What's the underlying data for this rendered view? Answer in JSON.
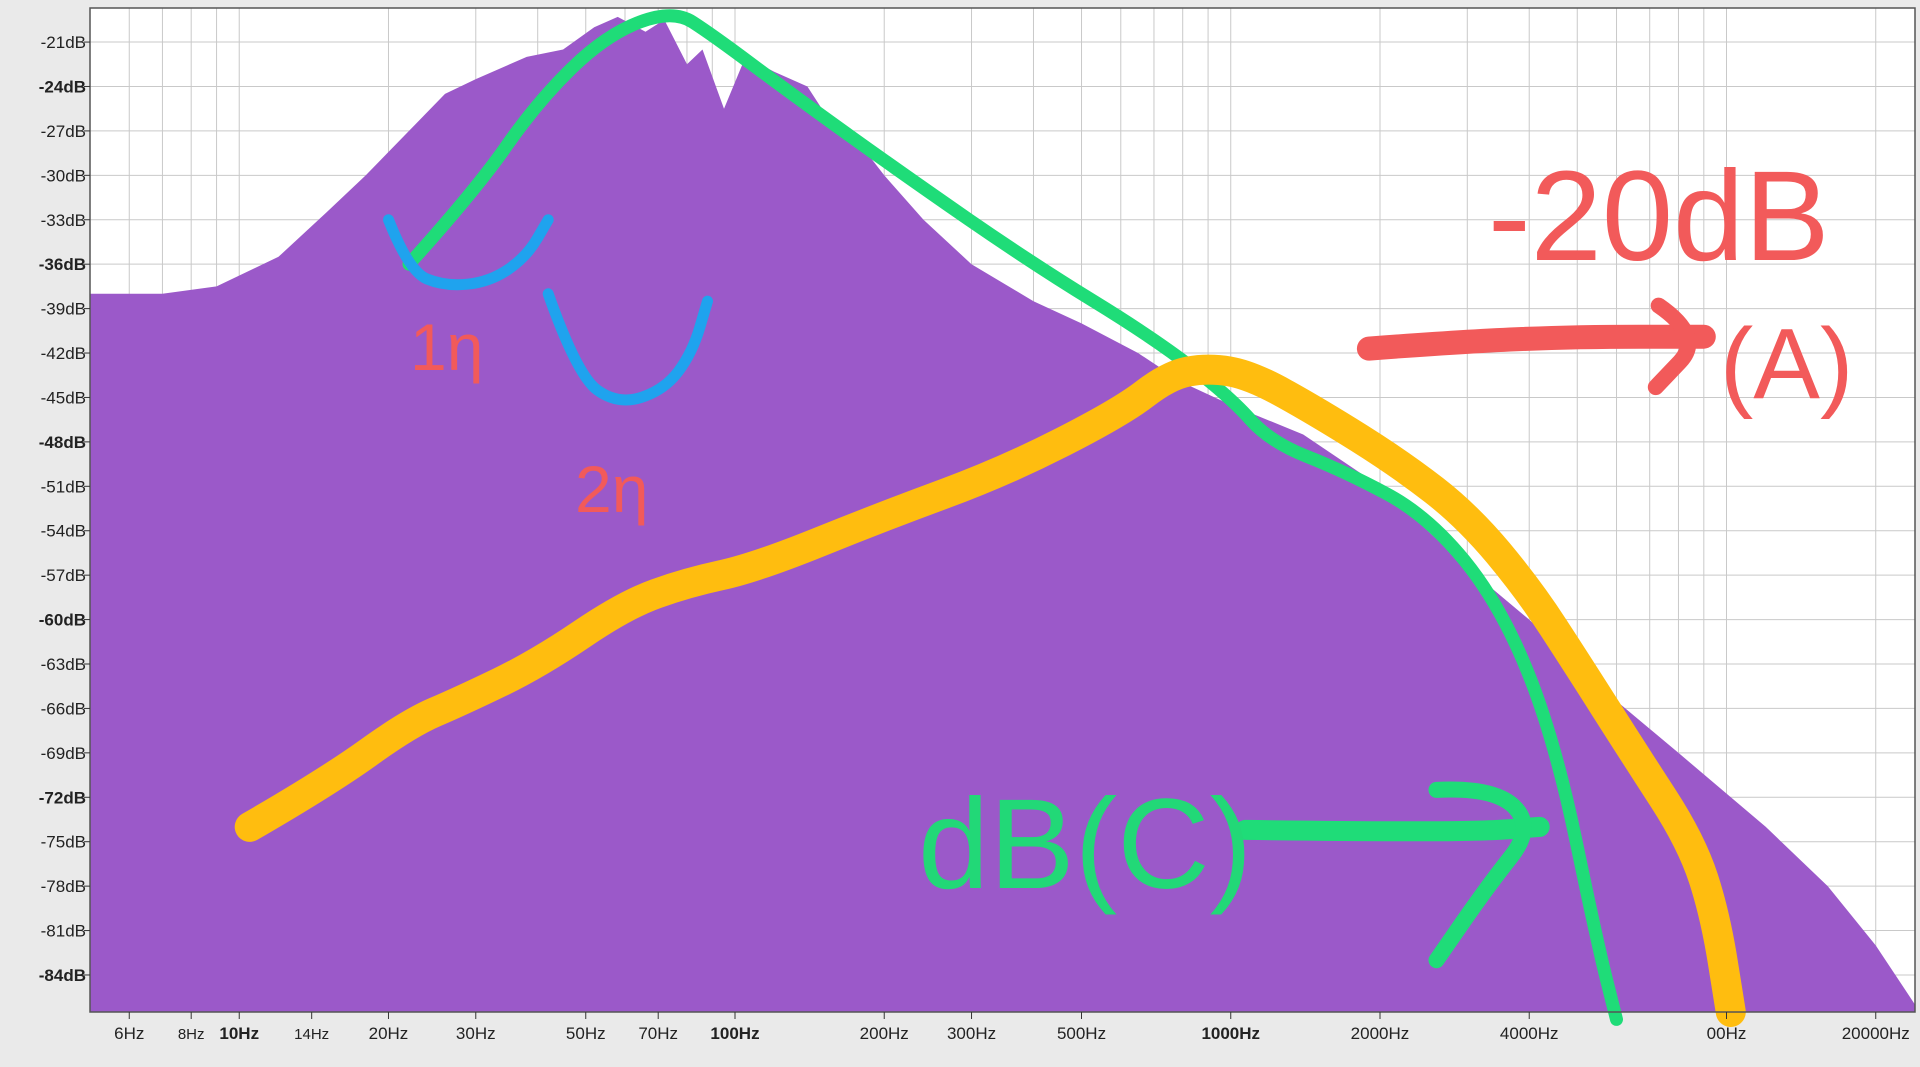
{
  "chart_data": {
    "type": "area",
    "title": "",
    "xlabel": "",
    "ylabel": "",
    "x_scale": "log",
    "xlim": [
      5,
      24000
    ],
    "ylim": [
      -86.5,
      -18.7
    ],
    "grid": true,
    "fill_color": "#9b59c9",
    "x_tick_labels": [
      {
        "hz": 6,
        "label": "6Hz",
        "bold": false,
        "small": false
      },
      {
        "hz": 8,
        "label": "8Hz",
        "bold": false,
        "small": true
      },
      {
        "hz": 10,
        "label": "10Hz",
        "bold": true,
        "small": false
      },
      {
        "hz": 14,
        "label": "14Hz",
        "bold": false,
        "small": true
      },
      {
        "hz": 20,
        "label": "20Hz",
        "bold": false,
        "small": false
      },
      {
        "hz": 30,
        "label": "30Hz",
        "bold": false,
        "small": false
      },
      {
        "hz": 50,
        "label": "50Hz",
        "bold": false,
        "small": false
      },
      {
        "hz": 70,
        "label": "70Hz",
        "bold": false,
        "small": false
      },
      {
        "hz": 100,
        "label": "100Hz",
        "bold": true,
        "small": false
      },
      {
        "hz": 200,
        "label": "200Hz",
        "bold": false,
        "small": false
      },
      {
        "hz": 300,
        "label": "300Hz",
        "bold": false,
        "small": false
      },
      {
        "hz": 500,
        "label": "500Hz",
        "bold": false,
        "small": false
      },
      {
        "hz": 1000,
        "label": "1000Hz",
        "bold": true,
        "small": false
      },
      {
        "hz": 2000,
        "label": "2000Hz",
        "bold": false,
        "small": false
      },
      {
        "hz": 4000,
        "label": "4000Hz",
        "bold": false,
        "small": false
      },
      {
        "hz": 10000,
        "label": "00Hz",
        "bold": false,
        "small": false
      },
      {
        "hz": 20000,
        "label": "20000Hz",
        "bold": false,
        "small": false
      }
    ],
    "y_tick_labels": [
      {
        "db": -21,
        "label": "-21dB",
        "bold": false
      },
      {
        "db": -24,
        "label": "-24dB",
        "bold": true
      },
      {
        "db": -27,
        "label": "-27dB",
        "bold": false
      },
      {
        "db": -30,
        "label": "-30dB",
        "bold": false
      },
      {
        "db": -33,
        "label": "-33dB",
        "bold": false
      },
      {
        "db": -36,
        "label": "-36dB",
        "bold": true
      },
      {
        "db": -39,
        "label": "-39dB",
        "bold": false
      },
      {
        "db": -42,
        "label": "-42dB",
        "bold": false
      },
      {
        "db": -45,
        "label": "-45dB",
        "bold": false
      },
      {
        "db": -48,
        "label": "-48dB",
        "bold": true
      },
      {
        "db": -51,
        "label": "-51dB",
        "bold": false
      },
      {
        "db": -54,
        "label": "-54dB",
        "bold": false
      },
      {
        "db": -57,
        "label": "-57dB",
        "bold": false
      },
      {
        "db": -60,
        "label": "-60dB",
        "bold": true
      },
      {
        "db": -63,
        "label": "-63dB",
        "bold": false
      },
      {
        "db": -66,
        "label": "-66dB",
        "bold": false
      },
      {
        "db": -69,
        "label": "-69dB",
        "bold": false
      },
      {
        "db": -72,
        "label": "-72dB",
        "bold": true
      },
      {
        "db": -75,
        "label": "-75dB",
        "bold": false
      },
      {
        "db": -78,
        "label": "-78dB",
        "bold": false
      },
      {
        "db": -81,
        "label": "-81dB",
        "bold": false
      },
      {
        "db": -84,
        "label": "-84dB",
        "bold": true
      }
    ],
    "series": [
      {
        "color": "#9b59c9",
        "points": [
          [
            5,
            -38
          ],
          [
            7,
            -38
          ],
          [
            9,
            -37.5
          ],
          [
            12,
            -35.5
          ],
          [
            15,
            -32.5
          ],
          [
            18,
            -30
          ],
          [
            22,
            -27
          ],
          [
            26,
            -24.5
          ],
          [
            30,
            -23.5
          ],
          [
            38,
            -22
          ],
          [
            45,
            -21.5
          ],
          [
            52,
            -20
          ],
          [
            58,
            -19.3
          ],
          [
            66,
            -20.3
          ],
          [
            72,
            -19.5
          ],
          [
            80,
            -22.5
          ],
          [
            86,
            -21.5
          ],
          [
            95,
            -25.5
          ],
          [
            105,
            -22
          ],
          [
            120,
            -23
          ],
          [
            140,
            -24
          ],
          [
            160,
            -27
          ],
          [
            175,
            -27.5
          ],
          [
            200,
            -30
          ],
          [
            240,
            -33
          ],
          [
            300,
            -36
          ],
          [
            400,
            -38.5
          ],
          [
            500,
            -40
          ],
          [
            650,
            -42
          ],
          [
            800,
            -44
          ],
          [
            1000,
            -45.5
          ],
          [
            1400,
            -47.5
          ],
          [
            2000,
            -51
          ],
          [
            3000,
            -56.5
          ],
          [
            4000,
            -60
          ],
          [
            6000,
            -65.5
          ],
          [
            8000,
            -69
          ],
          [
            12000,
            -74
          ],
          [
            16000,
            -78
          ],
          [
            20000,
            -82
          ],
          [
            24000,
            -86
          ]
        ]
      }
    ],
    "annotations": [
      {
        "text": "-20dB",
        "color": "#f25a5a"
      },
      {
        "text": "(A)",
        "color": "#f25a5a"
      },
      {
        "text": "1η",
        "color": "#f25a5a"
      },
      {
        "text": "2η",
        "color": "#f25a5a"
      },
      {
        "text": "dB(C)",
        "color": "#22d877"
      }
    ],
    "strokes": [
      {
        "name": "green-curve",
        "color": "#1fdc78",
        "points": [
          [
            22,
            -36
          ],
          [
            30,
            -31
          ],
          [
            40,
            -25
          ],
          [
            55,
            -20.5
          ],
          [
            75,
            -18.8
          ],
          [
            90,
            -20.5
          ],
          [
            130,
            -24.5
          ],
          [
            220,
            -30
          ],
          [
            400,
            -36
          ],
          [
            700,
            -41
          ],
          [
            1000,
            -45
          ],
          [
            1200,
            -48
          ],
          [
            1700,
            -50
          ],
          [
            2500,
            -53
          ],
          [
            3500,
            -59
          ],
          [
            4500,
            -68
          ],
          [
            5500,
            -82
          ],
          [
            6000,
            -87
          ]
        ]
      },
      {
        "name": "orange-curve",
        "color": "#ffbd0f",
        "points": [
          [
            10.5,
            -74
          ],
          [
            15,
            -71
          ],
          [
            22,
            -67
          ],
          [
            28,
            -65.5
          ],
          [
            40,
            -63
          ],
          [
            60,
            -59
          ],
          [
            80,
            -57.5
          ],
          [
            110,
            -56.5
          ],
          [
            200,
            -53
          ],
          [
            350,
            -50
          ],
          [
            600,
            -46
          ],
          [
            750,
            -43.5
          ],
          [
            900,
            -43
          ],
          [
            1100,
            -43.5
          ],
          [
            1500,
            -46
          ],
          [
            2200,
            -49.5
          ],
          [
            3000,
            -53
          ],
          [
            4000,
            -58
          ],
          [
            5000,
            -63
          ],
          [
            6500,
            -69
          ],
          [
            8500,
            -75
          ],
          [
            9500,
            -80
          ],
          [
            10200,
            -86.5
          ]
        ]
      },
      {
        "name": "blue-curve-1",
        "color": "#1fa3ee",
        "points": [
          [
            20,
            -33
          ],
          [
            22,
            -36.5
          ],
          [
            26,
            -37.5
          ],
          [
            32,
            -37.2
          ],
          [
            38,
            -35.5
          ],
          [
            42,
            -33
          ]
        ]
      },
      {
        "name": "blue-curve-2",
        "color": "#1fa3ee",
        "points": [
          [
            42,
            -38
          ],
          [
            48,
            -43.5
          ],
          [
            58,
            -45.5
          ],
          [
            72,
            -44.5
          ],
          [
            82,
            -42
          ],
          [
            88,
            -38.5
          ]
        ]
      },
      {
        "name": "red-arrow-line",
        "color": "#f25a5a",
        "points": [
          [
            1900,
            -41.7
          ],
          [
            3000,
            -41.2
          ],
          [
            5000,
            -40.9
          ],
          [
            9000,
            -40.9
          ]
        ]
      },
      {
        "name": "red-arrow-head",
        "color": "#f25a5a",
        "points": [
          [
            7300,
            -38.8
          ],
          [
            9000,
            -40.9
          ],
          [
            7200,
            -44.3
          ]
        ]
      },
      {
        "name": "green-arrow-line",
        "color": "#1fdc78",
        "points": [
          [
            1070,
            -74.2
          ],
          [
            1800,
            -74.3
          ],
          [
            3200,
            -74.3
          ],
          [
            4200,
            -74
          ]
        ]
      },
      {
        "name": "green-arrow-head",
        "color": "#1fdc78",
        "points": [
          [
            2600,
            -71.5
          ],
          [
            3400,
            -71.3
          ],
          [
            4100,
            -74
          ],
          [
            3300,
            -78
          ],
          [
            2600,
            -83
          ]
        ]
      }
    ]
  }
}
